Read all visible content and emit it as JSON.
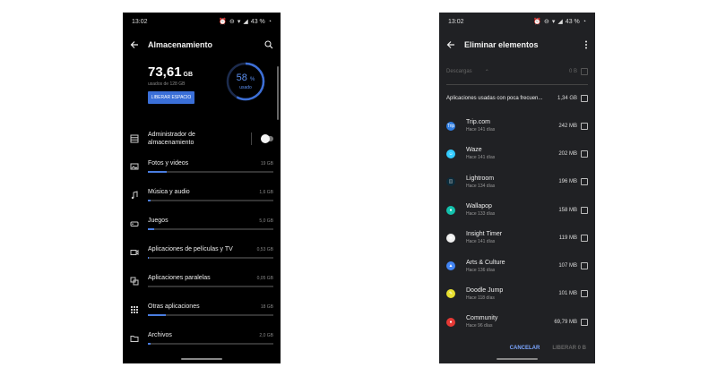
{
  "colors": {
    "accent": "#4a7de0",
    "ring": "#3d6fd6",
    "button": "#3a6fd8"
  },
  "phone1": {
    "status": {
      "time": "13:02",
      "battery": "43 %"
    },
    "title": "Almacenamiento",
    "summary": {
      "used_value": "73,61",
      "used_unit": "GB",
      "total_text": "usados de 128 GB",
      "free_button": "LIBERAR ESPACIO",
      "percent": "58",
      "percent_sign": "%",
      "percent_label": "usado",
      "ring_fraction": 0.58
    },
    "manager": {
      "label": "Administrador de almacenamiento",
      "enabled": false
    },
    "categories": [
      {
        "name": "Fotos y videos",
        "size": "19 GB",
        "icon": "image-icon",
        "fill": 0.15
      },
      {
        "name": "Música y audio",
        "size": "1,6 GB",
        "icon": "music-icon",
        "fill": 0.02
      },
      {
        "name": "Juegos",
        "size": "5,0 GB",
        "icon": "gamepad-icon",
        "fill": 0.05
      },
      {
        "name": "Aplicaciones de películas y TV",
        "size": "0,53 GB",
        "icon": "movie-icon",
        "fill": 0.01
      },
      {
        "name": "Aplicaciones paralelas",
        "size": "0,05 GB",
        "icon": "parallel-apps-icon",
        "fill": 0.0
      },
      {
        "name": "Otras aplicaciones",
        "size": "18 GB",
        "icon": "apps-grid-icon",
        "fill": 0.14
      },
      {
        "name": "Archivos",
        "size": "2,0 GB",
        "icon": "folder-icon",
        "fill": 0.02
      }
    ]
  },
  "phone2": {
    "status": {
      "time": "13:02",
      "battery": "43 %"
    },
    "title": "Eliminar elementos",
    "downloads": {
      "label": "Descargas",
      "size": "0 B"
    },
    "unused": {
      "label": "Aplicaciones usadas con poca frecuen...",
      "size": "1,34 GB"
    },
    "apps": [
      {
        "name": "Trip.com",
        "ago": "Hace 141 días",
        "size": "242 MB",
        "icon": "tripcom-icon",
        "color": "#2f7de1",
        "glyph": "Trip"
      },
      {
        "name": "Waze",
        "ago": "Hace 141 días",
        "size": "202 MB",
        "icon": "waze-icon",
        "color": "#33ccff",
        "glyph": "☺"
      },
      {
        "name": "Lightroom",
        "ago": "Hace 134 días",
        "size": "196 MB",
        "icon": "lightroom-icon",
        "color": "#0c2b3a",
        "glyph": "◫"
      },
      {
        "name": "Wallapop",
        "ago": "Hace 133 días",
        "size": "158 MB",
        "icon": "wallapop-icon",
        "color": "#13c1ac",
        "glyph": "●"
      },
      {
        "name": "Insight Timer",
        "ago": "Hace 141 días",
        "size": "119 MB",
        "icon": "insight-timer-icon",
        "color": "#f0f0f0",
        "glyph": "◉"
      },
      {
        "name": "Arts & Culture",
        "ago": "Hace 136 días",
        "size": "107 MB",
        "icon": "arts-culture-icon",
        "color": "#4285f4",
        "glyph": "▲"
      },
      {
        "name": "Doodle Jump",
        "ago": "Hace 118 días",
        "size": "101 MB",
        "icon": "doodle-jump-icon",
        "color": "#e8e030",
        "glyph": "✎"
      },
      {
        "name": "Community",
        "ago": "Hace 96 días",
        "size": "69,79 MB",
        "icon": "community-icon",
        "color": "#e53935",
        "glyph": "●"
      }
    ],
    "actions": {
      "cancel": "CANCELAR",
      "free": "LIBERAR 0 B"
    }
  }
}
